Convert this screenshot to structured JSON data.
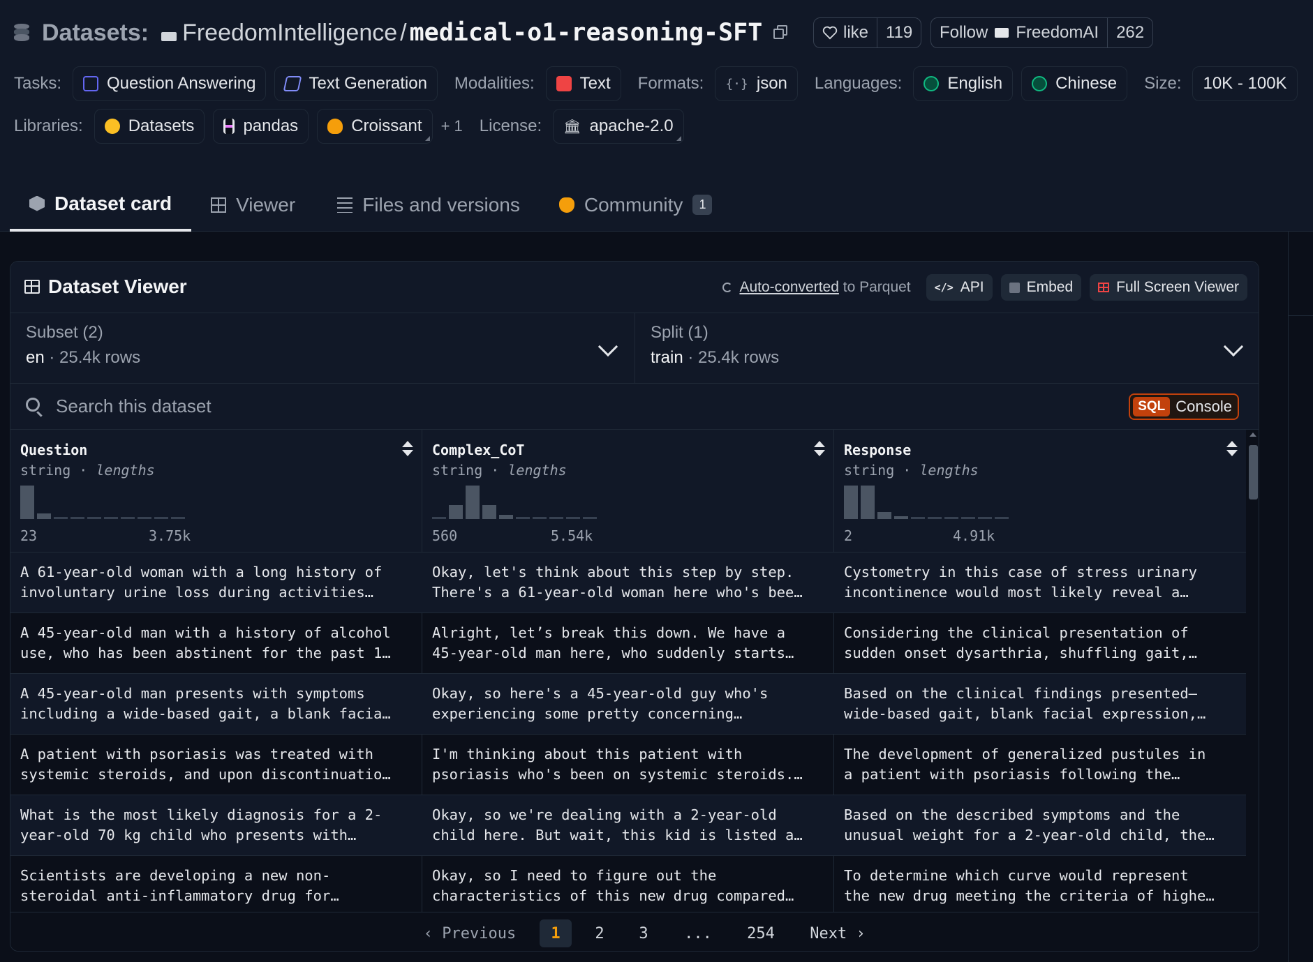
{
  "header": {
    "prefix": "Datasets:",
    "org": "FreedomIntelligence",
    "slash": "/",
    "repo": "medical-o1-reasoning-SFT",
    "like_label": "like",
    "like_count": "119",
    "follow_label": "Follow",
    "follow_org": "FreedomAI",
    "follow_count": "262"
  },
  "tags": {
    "tasks_label": "Tasks:",
    "tasks": [
      "Question Answering",
      "Text Generation"
    ],
    "modalities_label": "Modalities:",
    "modality": "Text",
    "formats_label": "Formats:",
    "format": "json",
    "languages_label": "Languages:",
    "languages": [
      "English",
      "Chinese"
    ],
    "size_label": "Size:",
    "size": "10K - 100K",
    "libraries_label": "Libraries:",
    "libraries": [
      "Datasets",
      "pandas",
      "Croissant"
    ],
    "more_libraries": "+ 1",
    "license_label": "License:",
    "license": "apache-2.0"
  },
  "tabs": [
    {
      "label": "Dataset card",
      "active": true,
      "icon": "cube-icon"
    },
    {
      "label": "Viewer",
      "active": false,
      "icon": "table-icon"
    },
    {
      "label": "Files and versions",
      "active": false,
      "icon": "files-icon"
    },
    {
      "label": "Community",
      "active": false,
      "icon": "community-icon",
      "badge": "1"
    }
  ],
  "viewer": {
    "title": "Dataset Viewer",
    "autoconv_link": "Auto-converted",
    "autoconv_rest": "to Parquet",
    "api_label": "API",
    "embed_label": "Embed",
    "fullscreen_label": "Full Screen Viewer",
    "subset": {
      "label": "Subset (2)",
      "value": "en",
      "rows": "25.4k rows"
    },
    "split": {
      "label": "Split (1)",
      "value": "train",
      "rows": "25.4k rows"
    },
    "search_placeholder": "Search this dataset",
    "sql_badge": "SQL",
    "sql_label": "Console",
    "columns": [
      {
        "name": "Question",
        "type": "string",
        "type_sep": "·",
        "stat": "lengths",
        "min": "23",
        "max": "3.75k",
        "hist": [
          0.95,
          0.15,
          0.06,
          0.06,
          0.06,
          0.06,
          0.06,
          0.06,
          0.06,
          0.06
        ]
      },
      {
        "name": "Complex_CoT",
        "type": "string",
        "type_sep": "·",
        "stat": "lengths",
        "min": "560",
        "max": "5.54k",
        "hist": [
          0.06,
          0.4,
          0.95,
          0.4,
          0.12,
          0.06,
          0.06,
          0.06,
          0.06,
          0.06
        ]
      },
      {
        "name": "Response",
        "type": "string",
        "type_sep": "·",
        "stat": "lengths",
        "min": "2",
        "max": "4.91k",
        "hist": [
          0.95,
          0.95,
          0.2,
          0.08,
          0.06,
          0.06,
          0.06,
          0.06,
          0.06,
          0.06
        ]
      }
    ],
    "rows": [
      [
        "A 61-year-old woman with a long history of\ninvoluntary urine loss during activities…",
        "Okay, let's think about this step by step.\nThere's a 61-year-old woman here who's bee…",
        "Cystometry in this case of stress urinary\nincontinence would most likely reveal a…"
      ],
      [
        "A 45-year-old man with a history of alcohol\nuse, who has been abstinent for the past 1…",
        "Alright, let’s break this down. We have a\n45-year-old man here, who suddenly starts…",
        "Considering the clinical presentation of\nsudden onset dysarthria, shuffling gait,…"
      ],
      [
        "A 45-year-old man presents with symptoms\nincluding a wide-based gait, a blank facia…",
        "Okay, so here's a 45-year-old guy who's\nexperiencing some pretty concerning…",
        "Based on the clinical findings presented—\nwide-based gait, blank facial expression,…"
      ],
      [
        "A patient with psoriasis was treated with\nsystemic steroids, and upon discontinuatio…",
        "I'm thinking about this patient with\npsoriasis who's been on systemic steroids.…",
        "The development of generalized pustules in\na patient with psoriasis following the…"
      ],
      [
        "What is the most likely diagnosis for a 2-\nyear-old 70 kg child who presents with…",
        "Okay, so we're dealing with a 2-year-old\nchild here. But wait, this kid is listed a…",
        "Based on the described symptoms and the\nunusual weight for a 2-year-old child, the…"
      ],
      [
        "Scientists are developing a new non-\nsteroidal anti-inflammatory drug for…",
        "Okay, so I need to figure out the\ncharacteristics of this new drug compared…",
        "To determine which curve would represent\nthe new drug meeting the criteria of highe…"
      ]
    ],
    "pager": {
      "prev": "‹  Previous",
      "pages": [
        "1",
        "2",
        "3",
        "...",
        "254"
      ],
      "current": "1",
      "next": "Next  ›"
    }
  }
}
